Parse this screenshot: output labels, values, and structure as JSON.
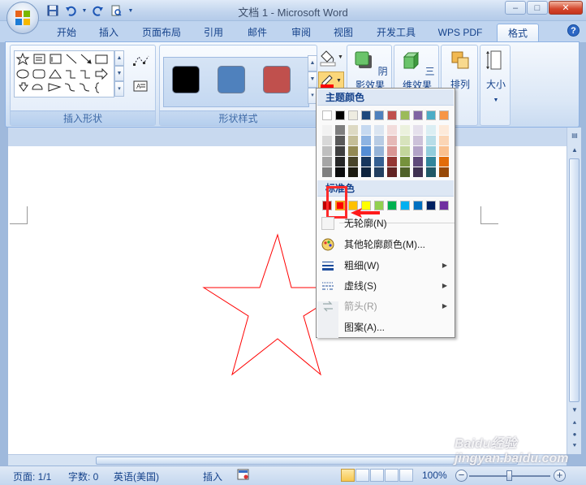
{
  "window": {
    "title": "文档 1 - Microsoft Word",
    "minimize": "–",
    "maximize": "□",
    "close": "✕"
  },
  "tabs": [
    {
      "label": "开始",
      "active": false
    },
    {
      "label": "插入",
      "active": false
    },
    {
      "label": "页面布局",
      "active": false
    },
    {
      "label": "引用",
      "active": false
    },
    {
      "label": "邮件",
      "active": false
    },
    {
      "label": "审阅",
      "active": false
    },
    {
      "label": "视图",
      "active": false
    },
    {
      "label": "开发工具",
      "active": false
    },
    {
      "label": "WPS PDF",
      "active": false
    },
    {
      "label": "格式",
      "active": true
    }
  ],
  "help_label": "?",
  "ribbon": {
    "groups": {
      "insert_shapes": {
        "label": "插入形状"
      },
      "shape_styles": {
        "label": "形状样式"
      }
    },
    "style_swatches": [
      "#000000",
      "#4f81bd",
      "#c0504d"
    ],
    "buttons": {
      "shadow_effects": "阴影效果",
      "3d_effects": "三维效果",
      "arrange": "排列",
      "size": "大小"
    }
  },
  "outline_menu": {
    "theme_colors_header": "主题颜色",
    "theme_top_row": [
      "#ffffff",
      "#000000",
      "#eeece1",
      "#1f497d",
      "#4f81bd",
      "#c0504d",
      "#9bbb59",
      "#8064a2",
      "#4bacc6",
      "#f79646"
    ],
    "theme_shades": [
      [
        "#f2f2f2",
        "#d8d8d8",
        "#bfbfbf",
        "#a5a5a5",
        "#7f7f7f"
      ],
      [
        "#7f7f7f",
        "#595959",
        "#3f3f3f",
        "#262626",
        "#0c0c0c"
      ],
      [
        "#ddd9c3",
        "#c4bd97",
        "#938953",
        "#494429",
        "#1d1b10"
      ],
      [
        "#c6d9f0",
        "#8db3e2",
        "#548dd4",
        "#17365d",
        "#0f243e"
      ],
      [
        "#dbe5f1",
        "#b8cce4",
        "#95b3d7",
        "#366092",
        "#244061"
      ],
      [
        "#f2dcdb",
        "#e5b9b7",
        "#d99694",
        "#953734",
        "#632423"
      ],
      [
        "#ebf1dd",
        "#d7e3bc",
        "#c3d69b",
        "#76923c",
        "#4f6128"
      ],
      [
        "#e5e0ec",
        "#ccc1d9",
        "#b2a2c7",
        "#5f497a",
        "#3f3151"
      ],
      [
        "#dbeef3",
        "#b7dde8",
        "#92cddc",
        "#31859b",
        "#205867"
      ],
      [
        "#fdeada",
        "#fbd5b5",
        "#fac08f",
        "#e36c09",
        "#974806"
      ]
    ],
    "standard_colors_header": "标准色",
    "standard_colors": [
      "#c00000",
      "#ff0000",
      "#ffc000",
      "#ffff00",
      "#92d050",
      "#00b050",
      "#00b0f0",
      "#0070c0",
      "#002060",
      "#7030a0"
    ],
    "selected_standard_color": "#ff0000",
    "items": [
      {
        "label": "无轮廓(N)",
        "submenu": false,
        "disabled": false
      },
      {
        "label": "其他轮廓颜色(M)...",
        "submenu": false,
        "disabled": false
      },
      {
        "label": "粗细(W)",
        "submenu": true,
        "disabled": false
      },
      {
        "label": "虚线(S)",
        "submenu": true,
        "disabled": false
      },
      {
        "label": "箭头(R)",
        "submenu": true,
        "disabled": true
      },
      {
        "label": "图案(A)...",
        "submenu": false,
        "disabled": false
      }
    ]
  },
  "document": {
    "star_outline_color": "#ff0000"
  },
  "statusbar": {
    "page": "页面: 1/1",
    "words": "字数: 0",
    "language": "英语(美国)",
    "mode": "插入",
    "zoom": "100%",
    "zoom_minus": "−",
    "zoom_plus": "+"
  },
  "watermark": "Baidu经验 jingyan.baidu.com"
}
